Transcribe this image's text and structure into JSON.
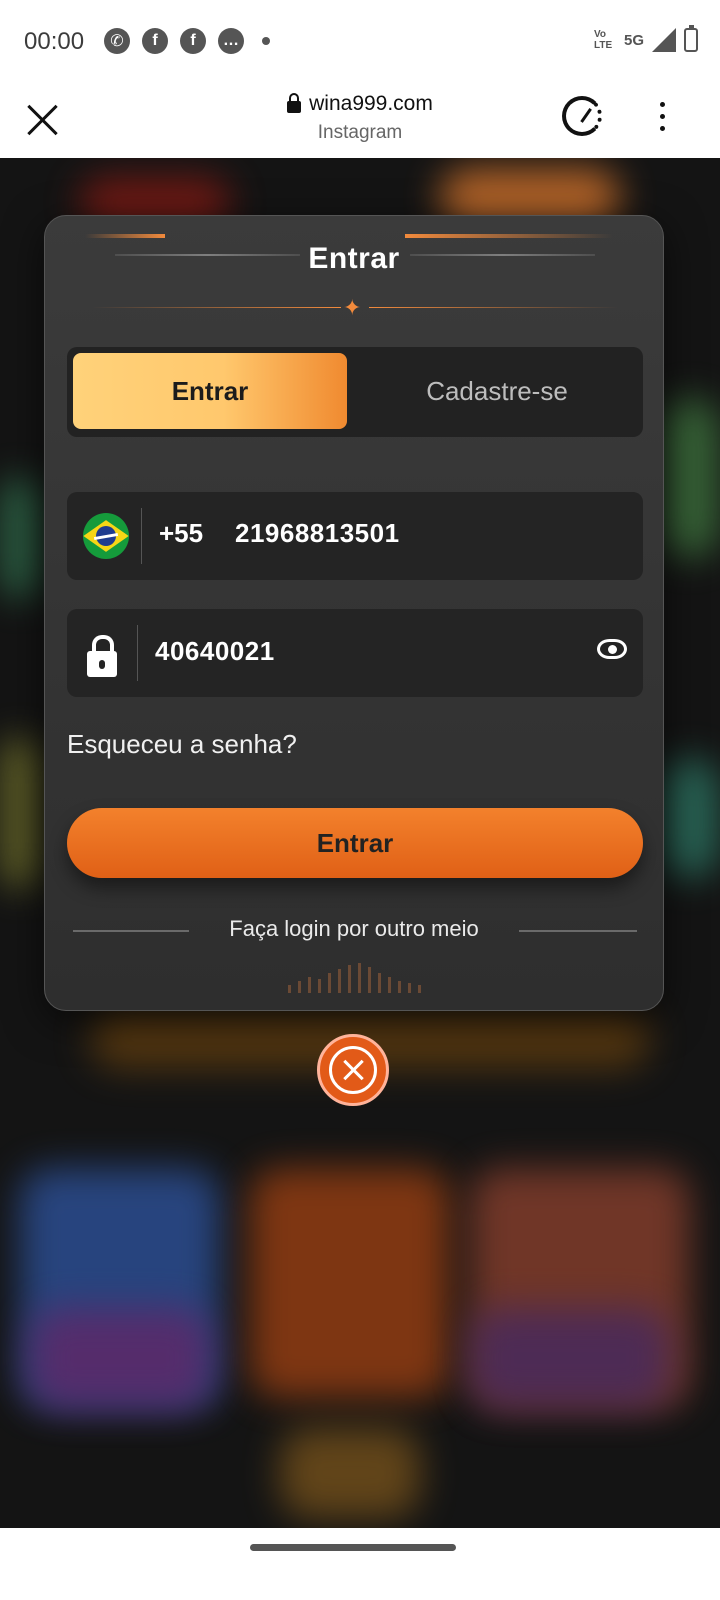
{
  "status_bar": {
    "time": "00:00",
    "network": "5G",
    "volte": "Vo LTE",
    "notification_icons": [
      "whatsapp-icon",
      "facebook-icon",
      "facebook-icon",
      "chat-icon"
    ]
  },
  "browser": {
    "domain": "wina999.com",
    "source": "Instagram"
  },
  "modal": {
    "title": "Entrar",
    "tabs": {
      "login": "Entrar",
      "register": "Cadastre-se"
    },
    "phone": {
      "country_code": "+55",
      "number": "21968813501"
    },
    "password": {
      "value": "40640021"
    },
    "forgot_label": "Esqueceu a senha?",
    "submit_label": "Entrar",
    "other_login_label": "Faça login por outro meio"
  },
  "colors": {
    "accent": "#f28a3c",
    "button": "#e8691f",
    "modal_bg": "#333333"
  }
}
